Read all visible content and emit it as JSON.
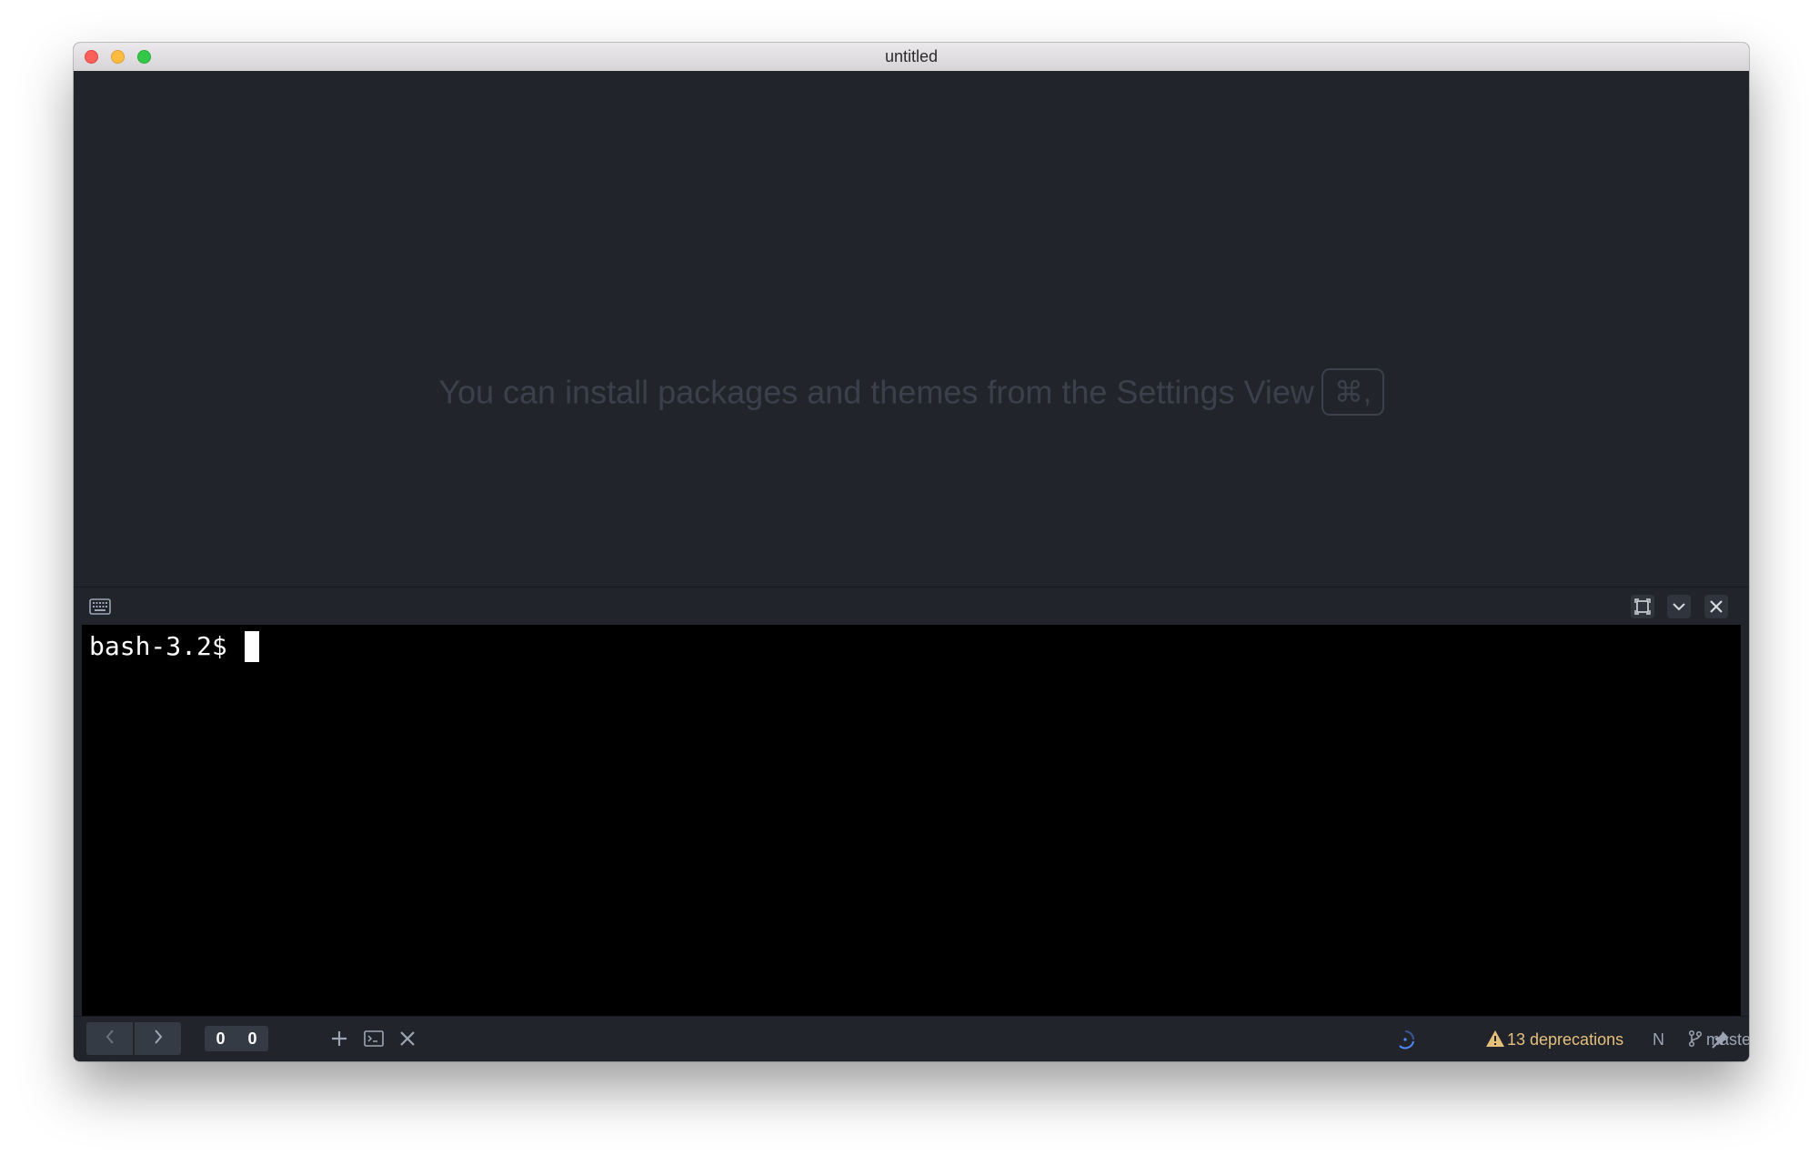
{
  "window": {
    "title": "untitled"
  },
  "editor": {
    "hint_text": "You can install packages and themes from the Settings View",
    "hint_shortcut": "⌘,"
  },
  "terminal": {
    "prompt": "bash-3.2$ "
  },
  "statusbar": {
    "count_left": "0",
    "count_right": "0",
    "deprecations": "13 deprecations",
    "mode_indicator": "N",
    "branch": "master"
  },
  "colors": {
    "editor_bg": "#21242b",
    "terminal_bg": "#000000",
    "warning": "#e5c07b",
    "accent": "#528bff"
  },
  "icons": {
    "keyboard": "keyboard-icon",
    "maximize": "maximize-icon",
    "minimize_panel": "chevron-down-icon",
    "close_panel": "close-icon",
    "back": "chevron-left-icon",
    "forward": "chevron-right-icon",
    "new_terminal": "plus-icon",
    "terminal": "terminal-icon",
    "close_terminal": "close-icon",
    "loading": "spinner-icon",
    "warning": "warning-icon",
    "branch": "git-branch-icon",
    "pin": "pin-icon"
  }
}
